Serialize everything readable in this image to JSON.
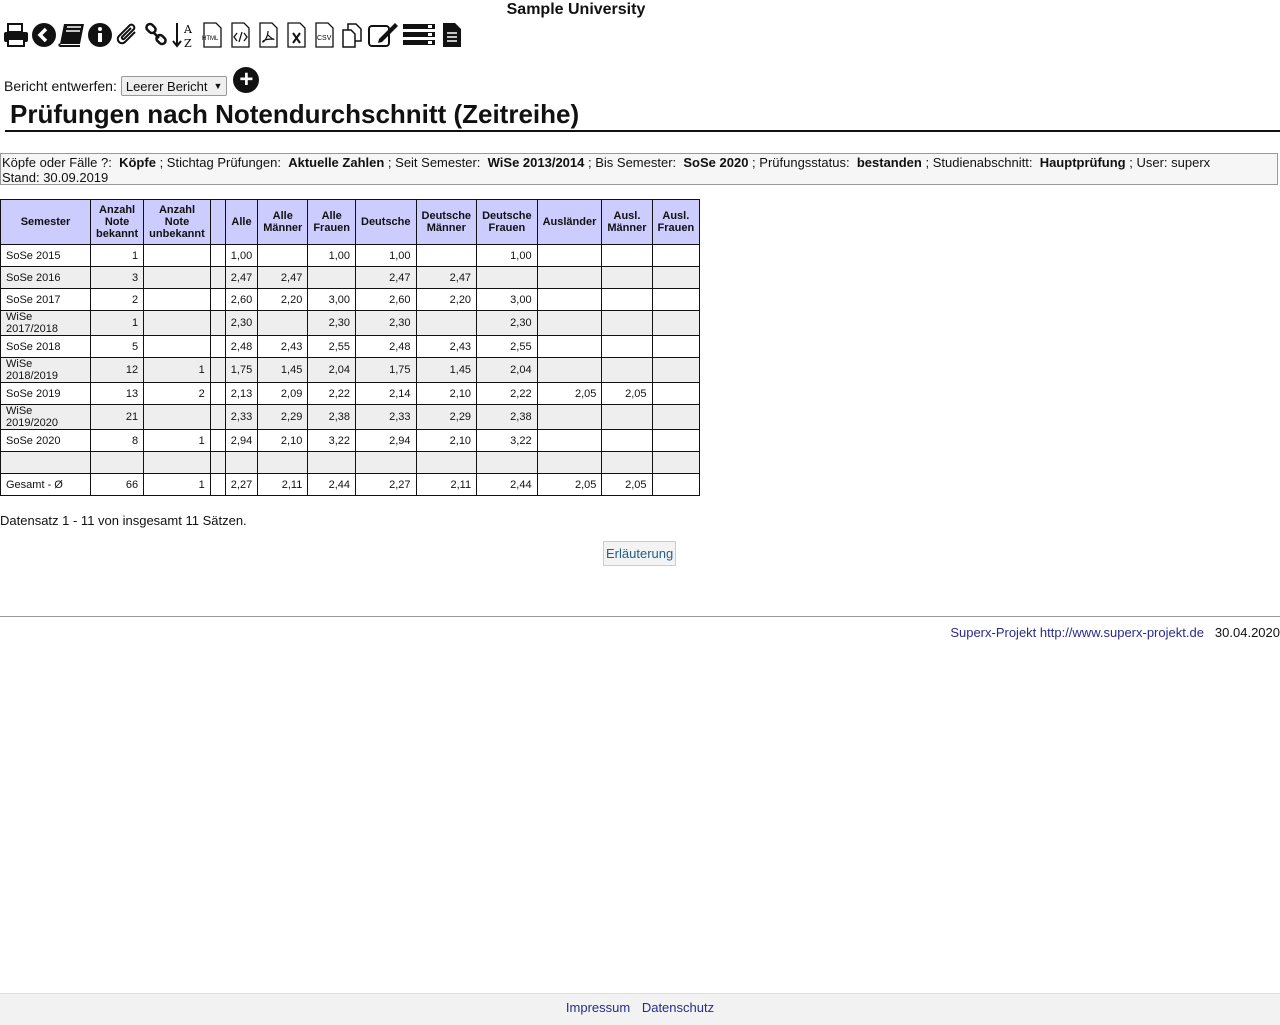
{
  "site": {
    "title": "Sample University"
  },
  "toolbar": {
    "icons": [
      "print-icon",
      "back-icon",
      "books-icon",
      "info-icon",
      "paperclip-icon",
      "link-icon",
      "sort-az-icon",
      "html-export-icon",
      "code-export-icon",
      "pdf-export-icon",
      "excel-export-icon",
      "csv-export-icon",
      "copy-icon",
      "edit-icon",
      "list-icon",
      "document-icon"
    ],
    "html_label": "HTML",
    "csv_label": "CSV",
    "sort_a": "A",
    "sort_z": "Z"
  },
  "designer": {
    "label": "Bericht entwerfen:",
    "selected": "Leerer Bericht"
  },
  "page": {
    "title": "Prüfungen nach Notendurchschnitt (Zeitreihe)"
  },
  "filter": {
    "k1": "Köpfe oder Fälle ?:",
    "v1": "Köpfe",
    "k2": "; Stichtag Prüfungen:",
    "v2": "Aktuelle Zahlen",
    "k3": "; Seit Semester:",
    "v3": "WiSe 2013/2014",
    "k4": "; Bis Semester:",
    "v4": "SoSe 2020",
    "k5": "; Prüfungsstatus:",
    "v5": "bestanden",
    "k6": "; Studienabschnitt:",
    "v6": "Hauptprüfung",
    "k7": "; User: superx",
    "stand": "Stand: 30.09.2019"
  },
  "table": {
    "headers": [
      "Semester",
      "Anzahl Note bekannt",
      "Anzahl Note unbekannt",
      "",
      "Alle",
      "Alle Männer",
      "Alle Frauen",
      "Deutsche",
      "Deutsche Männer",
      "Deutsche Frauen",
      "Ausländer",
      "Ausl. Männer",
      "Ausl. Frauen"
    ],
    "rows": [
      [
        "SoSe 2015",
        "1",
        "",
        "",
        "1,00",
        "",
        "1,00",
        "1,00",
        "",
        "1,00",
        "",
        "",
        ""
      ],
      [
        "SoSe 2016",
        "3",
        "",
        "",
        "2,47",
        "2,47",
        "",
        "2,47",
        "2,47",
        "",
        "",
        "",
        ""
      ],
      [
        "SoSe 2017",
        "2",
        "",
        "",
        "2,60",
        "2,20",
        "3,00",
        "2,60",
        "2,20",
        "3,00",
        "",
        "",
        ""
      ],
      [
        "WiSe 2017/2018",
        "1",
        "",
        "",
        "2,30",
        "",
        "2,30",
        "2,30",
        "",
        "2,30",
        "",
        "",
        ""
      ],
      [
        "SoSe 2018",
        "5",
        "",
        "",
        "2,48",
        "2,43",
        "2,55",
        "2,48",
        "2,43",
        "2,55",
        "",
        "",
        ""
      ],
      [
        "WiSe 2018/2019",
        "12",
        "1",
        "",
        "1,75",
        "1,45",
        "2,04",
        "1,75",
        "1,45",
        "2,04",
        "",
        "",
        ""
      ],
      [
        "SoSe 2019",
        "13",
        "2",
        "",
        "2,13",
        "2,09",
        "2,22",
        "2,14",
        "2,10",
        "2,22",
        "2,05",
        "2,05",
        ""
      ],
      [
        "WiSe 2019/2020",
        "21",
        "",
        "",
        "2,33",
        "2,29",
        "2,38",
        "2,33",
        "2,29",
        "2,38",
        "",
        "",
        ""
      ],
      [
        "SoSe 2020",
        "8",
        "1",
        "",
        "2,94",
        "2,10",
        "3,22",
        "2,94",
        "2,10",
        "3,22",
        "",
        "",
        ""
      ],
      [
        "",
        "",
        "",
        "",
        "",
        "",
        "",
        "",
        "",
        "",
        "",
        "",
        ""
      ],
      [
        "Gesamt - Ø",
        "66",
        "1",
        "",
        "2,27",
        "2,11",
        "2,44",
        "2,27",
        "2,11",
        "2,44",
        "2,05",
        "2,05",
        ""
      ]
    ]
  },
  "records": {
    "text": "Datensatz 1 - 11 von insgesamt 11 Sätzen."
  },
  "explain": {
    "label": "Erläuterung"
  },
  "credit": {
    "link": "Superx-Projekt http://www.superx-projekt.de",
    "date": "30.04.2020"
  },
  "footer": {
    "impressum": "Impressum",
    "datenschutz": "Datenschutz"
  }
}
